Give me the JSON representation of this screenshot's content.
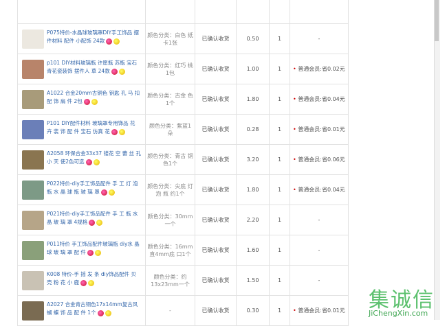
{
  "rows": [
    {
      "name": "",
      "variant": "",
      "status": "",
      "price": "",
      "qty": "",
      "discount": ""
    },
    {
      "name": "P075特价-水晶球玻璃罩DIY手工饰品 摆 件材料 配件 小配饰 24款",
      "variant": "颜色分类：白色 纸卡1张",
      "status": "已确认收货",
      "price": "0.50",
      "qty": "1",
      "discount": "-"
    },
    {
      "name": "p101 DIY材料玻璃瓶 许愿瓶 苏瓶 宝石青花瓷装饰 摆件人 草 24款",
      "variant": "颜色分类：红巧 桃1包",
      "status": "已确认收货",
      "price": "1.00",
      "qty": "1",
      "discount": "普通会员:省0.02元"
    },
    {
      "name": "A1022 合金20mm古铜色 钥匙 孔 马 扣 配 饰 扇 件 2包",
      "variant": "颜色分类：古金 色1个",
      "status": "已确认收货",
      "price": "1.80",
      "qty": "1",
      "discount": "普通会员:省0.04元"
    },
    {
      "name": "P101 DIY配件材料 玻璃罩专用饰品 花 卉 装 饰 配 件 宝石 仿真 花",
      "variant": "颜色分类：紫蓝1 朵",
      "status": "已确认收货",
      "price": "0.28",
      "qty": "1",
      "discount": "普通会员:省0.01元"
    },
    {
      "name": "A2058 环保合金33x37 镂花 空 蕾 丝 孔 小 天 使2色可选",
      "variant": "颜色分类：青古 铜色1个",
      "status": "已确认收货",
      "price": "3.20",
      "qty": "1",
      "discount": "普通会员:省0.06元"
    },
    {
      "name": "P022特价-diy手工饰品配件 手 工 灯 泡 瓶 水 晶 球 瓶 玻 璃 罩",
      "variant": "颜色分类：尖底 灯 泡 瓶 约1个",
      "status": "已确认收货",
      "price": "1.80",
      "qty": "1",
      "discount": "普通会员:省0.04元"
    },
    {
      "name": "P021特价-diy手工饰品配件 手 工 瓶 水 晶 玻 璃 罩 4规格",
      "variant": "颜色分类：30mm一个",
      "status": "已确认收货",
      "price": "2.20",
      "qty": "1",
      "discount": "-"
    },
    {
      "name": "P011特价 手工饰品配件玻璃瓶 diy水 晶 球 玻 璃 罩 配 件",
      "variant": "颜色分类：16mm直4mm底 口1个",
      "status": "已确认收货",
      "price": "1.60",
      "qty": "1",
      "discount": "-"
    },
    {
      "name": "K008 特价-手 摇 发 条 diy饰品配件 贝 壳 粉 花 小 鹿",
      "variant": "颜色分类：约 13x23mm一个",
      "status": "已确认收货",
      "price": "1.50",
      "qty": "1",
      "discount": "-"
    },
    {
      "name": "A2027 合金青古铜色17x14mm复古风 蝴 蝶 饰 品 配 件 1个",
      "variant": "-",
      "status": "已确认收货",
      "price": "0.30",
      "qty": "1",
      "discount": "普通会员:省0.01元"
    }
  ],
  "thumbs": [
    "#d9d2c8",
    "#ece8e0",
    "#b8846a",
    "#a89b7a",
    "#6b7fb8",
    "#8a7550",
    "#7d9a86",
    "#b6a588",
    "#8aa07a",
    "#c9c2b4",
    "#7a6b52"
  ],
  "watermark": {
    "cn": "集诚信",
    "en": "JiChengXin.com"
  }
}
